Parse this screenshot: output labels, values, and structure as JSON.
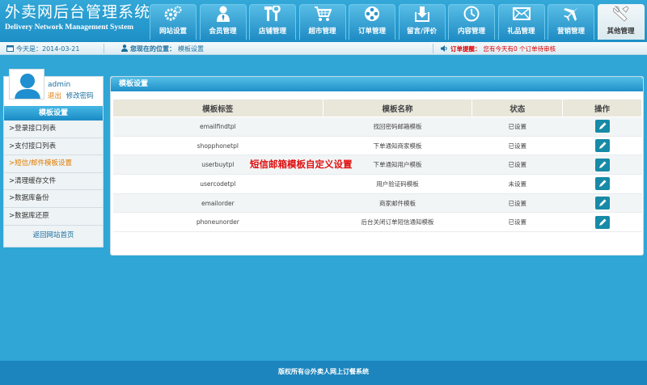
{
  "header": {
    "title_cn": "外卖网后台管理系统",
    "title_en": "Delivery Network Management System"
  },
  "nav": [
    {
      "label": "网站设置",
      "icon": "gears-icon"
    },
    {
      "label": "会员管理",
      "icon": "user-icon"
    },
    {
      "label": "店铺管理",
      "icon": "tools-icon"
    },
    {
      "label": "超市管理",
      "icon": "cart-icon"
    },
    {
      "label": "订单管理",
      "icon": "film-reel-icon"
    },
    {
      "label": "留言/评价",
      "icon": "download-box-icon"
    },
    {
      "label": "内容管理",
      "icon": "clock-icon"
    },
    {
      "label": "礼品管理",
      "icon": "mail-icon"
    },
    {
      "label": "营销管理",
      "icon": "plane-icon"
    },
    {
      "label": "其他管理",
      "icon": "wrench-icon",
      "active": true
    }
  ],
  "infobar": {
    "date": "今天是：2014-03-21",
    "location_label": "您现在的位置：",
    "location": "模板设置",
    "order_alert_label": "订单提醒：",
    "order_alert": "您有今天有0 个订单待审核"
  },
  "sidebar": {
    "username": "admin",
    "logout": "退出",
    "change_password": "修改密码",
    "title": "模板设置",
    "items": [
      "登录接口列表",
      "支付接口列表",
      "短信/邮件模板设置",
      "清理缓存文件",
      "数据库备份",
      "数据库还原"
    ],
    "active_index": 2,
    "back_home": "返回网站首页"
  },
  "panel": {
    "title": "模板设置",
    "columns": [
      "模板标签",
      "模板名称",
      "状态",
      "操作"
    ],
    "rows": [
      {
        "tag": "emailfindtpl",
        "name": "找回密码邮箱模板",
        "status": "已设置"
      },
      {
        "tag": "shopphonetpl",
        "name": "下单通知商家模板",
        "status": "已设置"
      },
      {
        "tag": "userbuytpl",
        "name": "下单通知用户模板",
        "status": "已设置"
      },
      {
        "tag": "usercodetpl",
        "name": "用户验证码模板",
        "status": "未设置"
      },
      {
        "tag": "emailorder",
        "name": "商家邮件模板",
        "status": "已设置"
      },
      {
        "tag": "phoneunorder",
        "name": "后台关闭订单短信通知模板",
        "status": "已设置"
      }
    ],
    "overlay_text": "短信邮箱模板自定义设置"
  },
  "footer": {
    "copyright": "版权所有@外卖人网上订餐系统"
  },
  "colors": {
    "brand": "#1d8fc6",
    "accent": "#e07b00",
    "alert": "#dd0000",
    "edit_button": "#178aa7"
  }
}
